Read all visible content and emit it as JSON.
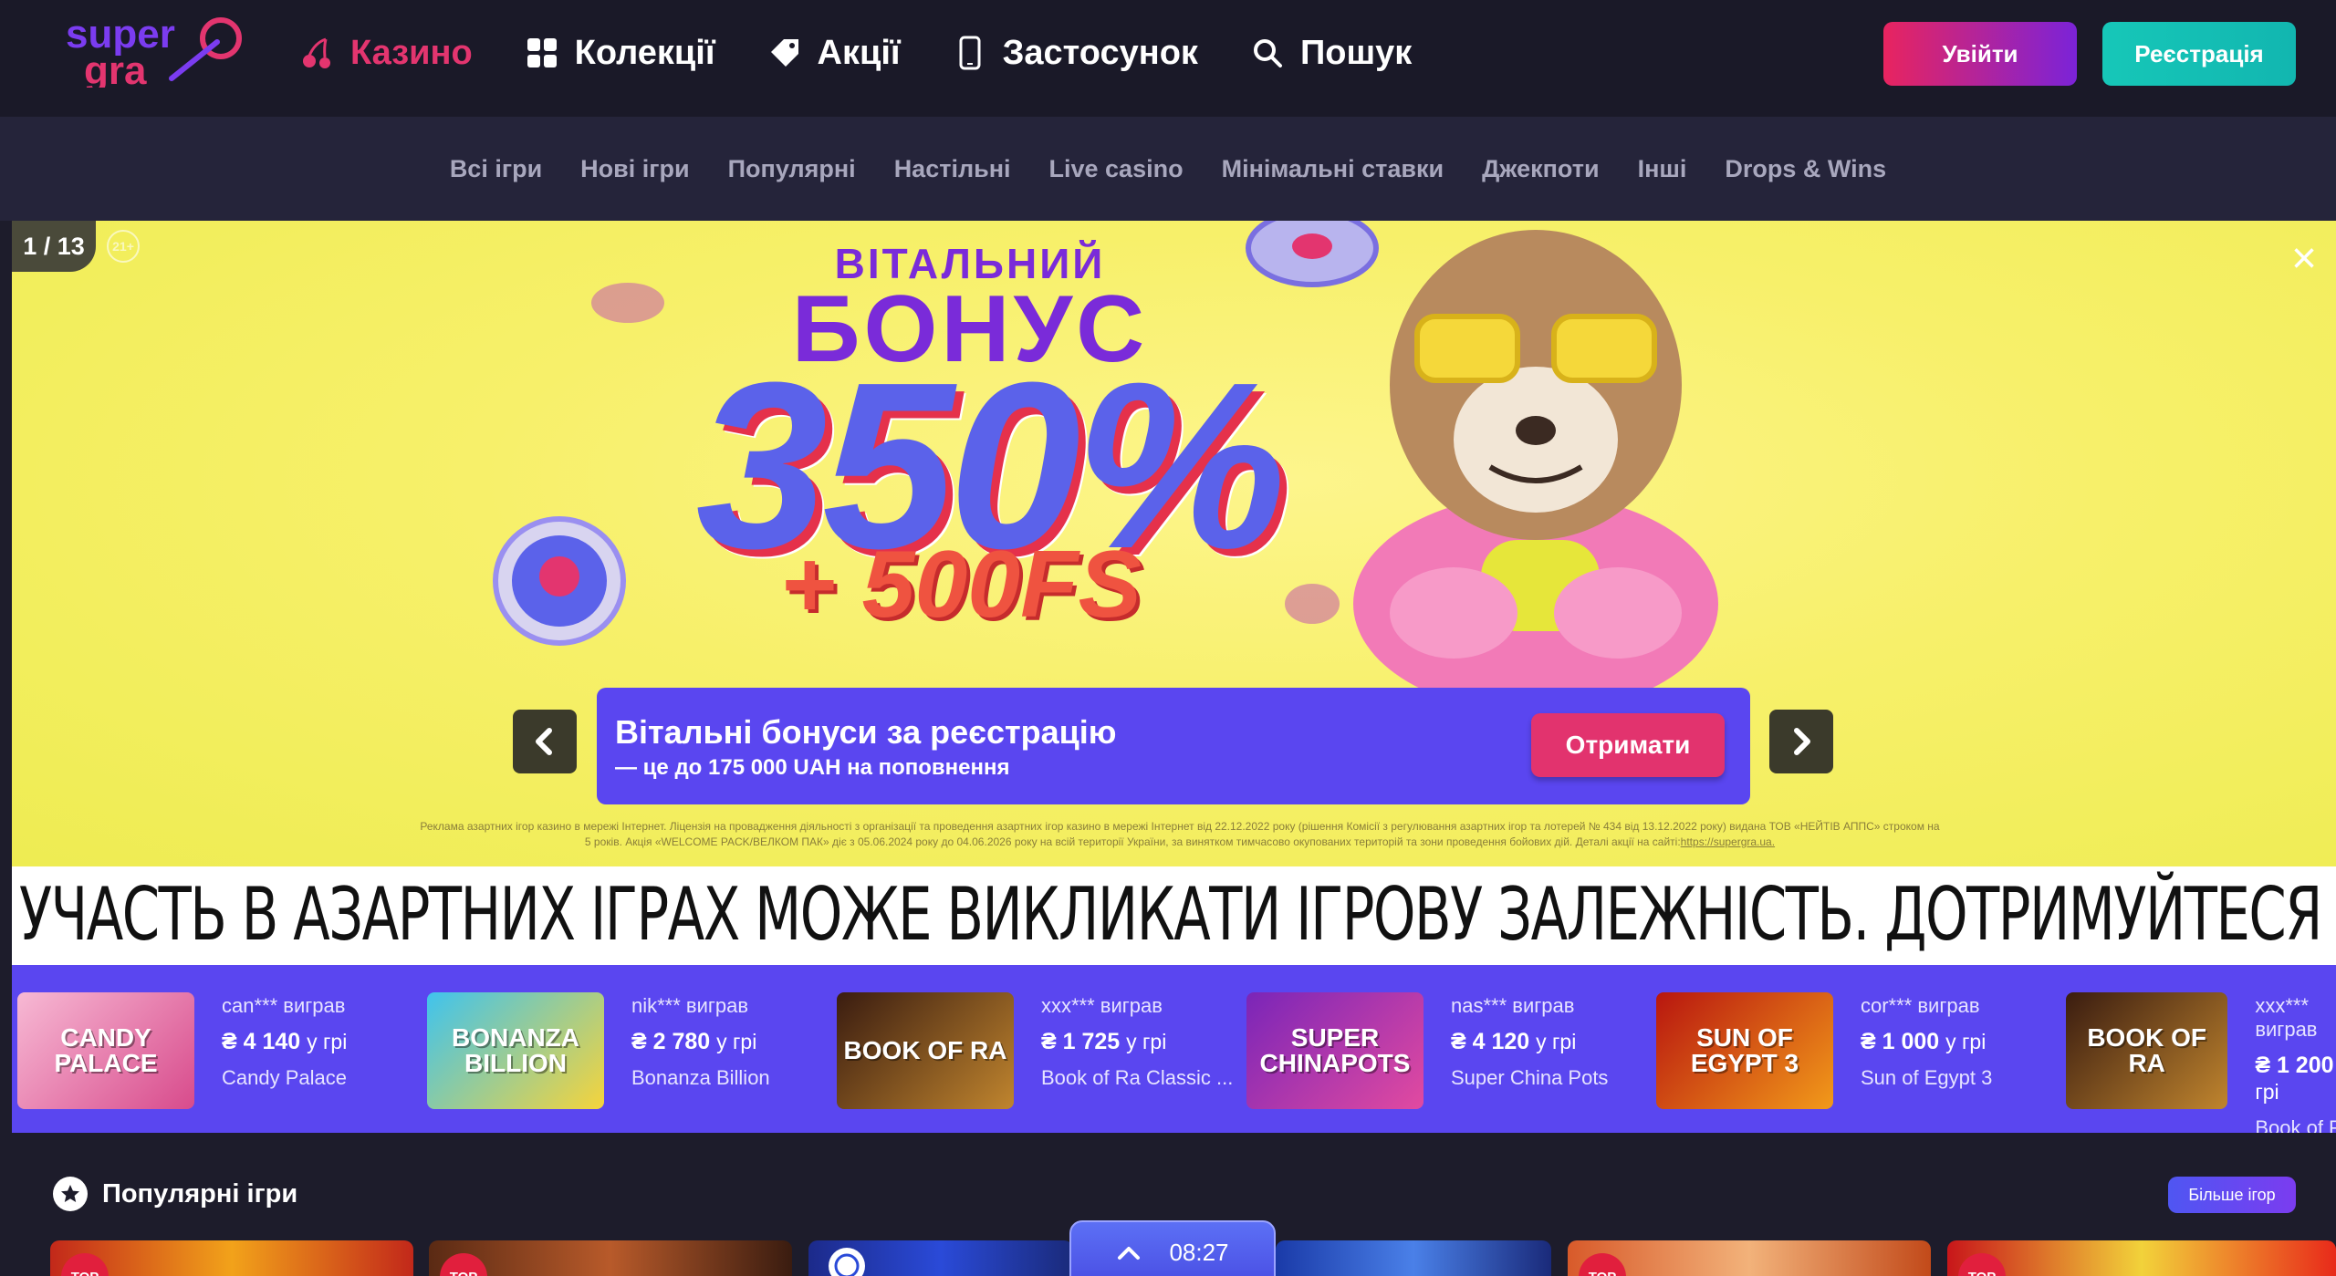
{
  "header": {
    "logo_alt": "super gra",
    "nav": [
      {
        "label": "Казино",
        "icon": "cherry-icon",
        "active": true
      },
      {
        "label": "Колекції",
        "icon": "grid-icon",
        "active": false
      },
      {
        "label": "Акції",
        "icon": "tag-icon",
        "active": false
      },
      {
        "label": "Застосунок",
        "icon": "phone-icon",
        "active": false
      },
      {
        "label": "Пошук",
        "icon": "search-icon",
        "active": false
      }
    ],
    "login_label": "Увійти",
    "register_label": "Реєстрація"
  },
  "subnav": [
    "Всі ігри",
    "Нові ігри",
    "Популярні",
    "Настільні",
    "Live casino",
    "Мінімальні ставки",
    "Джекпоти",
    "Інші",
    "Drops & Wins"
  ],
  "banner": {
    "counter": "1 / 13",
    "age": "21+",
    "headline_small": "ВІТАЛЬНИЙ",
    "headline_big": "БОНУС",
    "percent": "350%",
    "free_spins": "+ 500FS",
    "card_title": "Вітальні бонуси за реєстрацію",
    "card_subtitle": "— це до 175 000 UAH на поповнення",
    "cta_label": "Отримати",
    "disclaimer_line1": "Реклама азартних ігор казино в мережі Інтернет. Ліцензія на провадження діяльності з організації та проведення азартних ігор казино в мережі Інтернет від 22.12.2022 року (рішення Комісії з регулювання азартних ігор та лотерей № 434 від 13.12.2022 року) видана ТОВ «НЕЙТІВ АППС» строком на",
    "disclaimer_line2": "5 років. Акція «WELCOME PACK/ВЕЛКОМ ПАК» діє з 05.06.2024 року до 04.06.2026 року на всій території України, за винятком тимчасово окупованих територій та зони проведення бойових дій. Деталі акції на сайті:",
    "disclaimer_link": "https://supergra.ua."
  },
  "warning": "УЧАСТЬ В АЗАРТНИХ ІГРАХ МОЖЕ ВИКЛИКАТИ ІГРОВУ ЗАЛЕЖНІСТЬ. ДОТРИМУЙТЕСЯ ПРАВИЛ (ПРИНЦИПІВ) ВІДПОВІДАЛЬНОЇ ГРИ",
  "wins": [
    {
      "user": "can*** виграв",
      "amount": "₴ 4 140",
      "suffix": "у грі",
      "game": "Candy Palace",
      "thumb": "CANDY PALACE",
      "colors": [
        "#f7b9d4",
        "#d84b8c"
      ]
    },
    {
      "user": "nik*** виграв",
      "amount": "₴ 2 780",
      "suffix": "у грі",
      "game": "Bonanza Billion",
      "thumb": "BONANZA BILLION",
      "colors": [
        "#3fc3ee",
        "#f6d43b"
      ]
    },
    {
      "user": "xxx*** виграв",
      "amount": "₴ 1 725",
      "suffix": "у грі",
      "game": "Book of Ra Classic ...",
      "thumb": "BOOK OF RA",
      "colors": [
        "#3a1c10",
        "#c0852e"
      ]
    },
    {
      "user": "nas*** виграв",
      "amount": "₴ 4 120",
      "suffix": "у грі",
      "game": "Super China Pots",
      "thumb": "SUPER CHINAPOTS",
      "colors": [
        "#7a25b8",
        "#e24aa0"
      ]
    },
    {
      "user": "cor*** виграв",
      "amount": "₴ 1 000",
      "suffix": "у грі",
      "game": "Sun of Egypt 3",
      "thumb": "SUN OF EGYPT 3",
      "colors": [
        "#b8160f",
        "#f29a1a"
      ]
    },
    {
      "user": "xxx*** виграв",
      "amount": "₴ 1 200",
      "suffix": "у грі",
      "game": "Book of Ra",
      "thumb": "BOOK OF RA",
      "colors": [
        "#3a1c10",
        "#c0852e"
      ]
    }
  ],
  "popular": {
    "title": "Популярні ігри",
    "more_label": "Більше ігор",
    "top_badge": "TOP"
  },
  "timer": {
    "time": "08:27"
  }
}
